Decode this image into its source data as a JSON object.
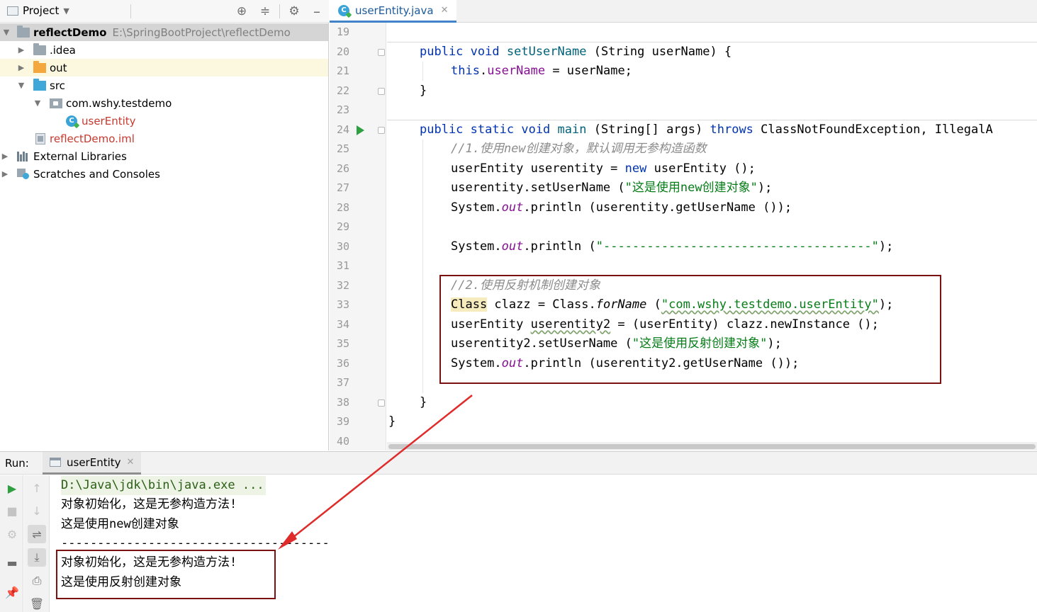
{
  "project_panel": {
    "title": "Project",
    "tree": [
      {
        "label": "reflectDemo",
        "path": "E:\\SpringBootProject\\reflectDemo"
      },
      {
        "label": ".idea"
      },
      {
        "label": "out"
      },
      {
        "label": "src"
      },
      {
        "label": "com.wshy.testdemo"
      },
      {
        "label": "userEntity"
      },
      {
        "label": "reflectDemo.iml"
      },
      {
        "label": "External Libraries"
      },
      {
        "label": "Scratches and Consoles"
      }
    ]
  },
  "editor": {
    "tab_label": "userEntity.java",
    "line_numbers": [
      "19",
      "20",
      "21",
      "22",
      "23",
      "24",
      "25",
      "26",
      "27",
      "28",
      "29",
      "30",
      "31",
      "32",
      "33",
      "34",
      "35",
      "36",
      "37",
      "38",
      "39",
      "40"
    ],
    "code": {
      "l20": {
        "kw1": "public",
        "kw2": "void",
        "name": "setUserName",
        "rest": " (String userName) {"
      },
      "l21": {
        "kw": "this",
        "dot": ".",
        "field": "userName",
        "rest": " = userName;"
      },
      "l22": "}",
      "l24": {
        "kw1": "public",
        "kw2": "static",
        "kw3": "void",
        "name": "main",
        "mid": " (String[] args) ",
        "throws": "throws",
        "rest": " ClassNotFoundException, IllegalA"
      },
      "l25": "//1.使用new创建对象，默认调用无参构造函数",
      "l26": {
        "a": "userEntity userentity = ",
        "kw": "new",
        "b": " userEntity ();"
      },
      "l27": {
        "a": "userentity.setUserName (",
        "str": "\"这是使用new创建对象\"",
        "b": ");"
      },
      "l28": {
        "a": "System.",
        "out": "out",
        "b": ".println (userentity.getUserName ());"
      },
      "l30": {
        "a": "System.",
        "out": "out",
        "b": ".println (",
        "str": "\"-------------------------------------\"",
        "c": ");"
      },
      "l32": "//2.使用反射机制创建对象",
      "l33": {
        "cls": "Class",
        "a": " clazz = Class.",
        "fn": "forName",
        "b": " (",
        "str": "\"com.wshy.testdemo.userEntity\"",
        "c": ");"
      },
      "l34": {
        "a": "userEntity ",
        "var": "userentity2",
        "b": " = (userEntity) clazz.newInstance ();"
      },
      "l35": {
        "a": "userentity2.setUserName (",
        "str": "\"这是使用反射创建对象\"",
        "b": ");"
      },
      "l36": {
        "a": "System.",
        "out": "out",
        "b": ".println (userentity2.getUserName ());"
      },
      "l38": "}",
      "l39": "}"
    }
  },
  "run_panel": {
    "label": "Run:",
    "tab_label": "userEntity",
    "console_lines": [
      "D:\\Java\\jdk\\bin\\java.exe ...",
      "对象初始化，这是无参构造方法!",
      "这是使用new创建对象",
      "-------------------------------------",
      "对象初始化，这是无参构造方法!",
      "这是使用反射创建对象"
    ]
  },
  "colors": {
    "annotation": "#7b1111",
    "arrow": "#e02b2b",
    "keyword": "#0033b3",
    "string": "#067d17",
    "comment": "#8c8c8c",
    "field": "#871094"
  }
}
